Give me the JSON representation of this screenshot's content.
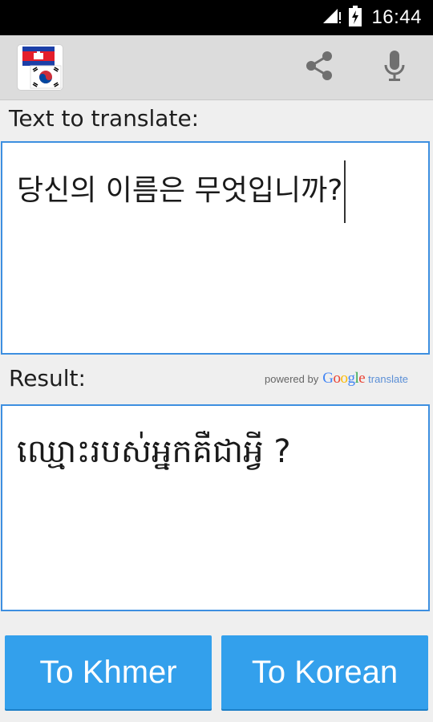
{
  "status_bar": {
    "time": "16:44"
  },
  "action_bar": {
    "app_icon": "cambodia-korea-flags-icon",
    "share_icon": "share-icon",
    "mic_icon": "microphone-icon"
  },
  "input": {
    "label": "Text to translate:",
    "value": "당신의 이름은 무엇입니까?"
  },
  "result": {
    "label": "Result:",
    "value": "ឈ្មោះរបស់អ្នកគឺជាអ្វី ?",
    "powered_by": "powered by",
    "google": "Google",
    "translate": "translate"
  },
  "buttons": {
    "to_khmer": "To Khmer",
    "to_korean": "To Korean"
  },
  "colors": {
    "accent": "#33a0ec",
    "border": "#3d8fe0",
    "action_bar": "#dcdcdc"
  }
}
